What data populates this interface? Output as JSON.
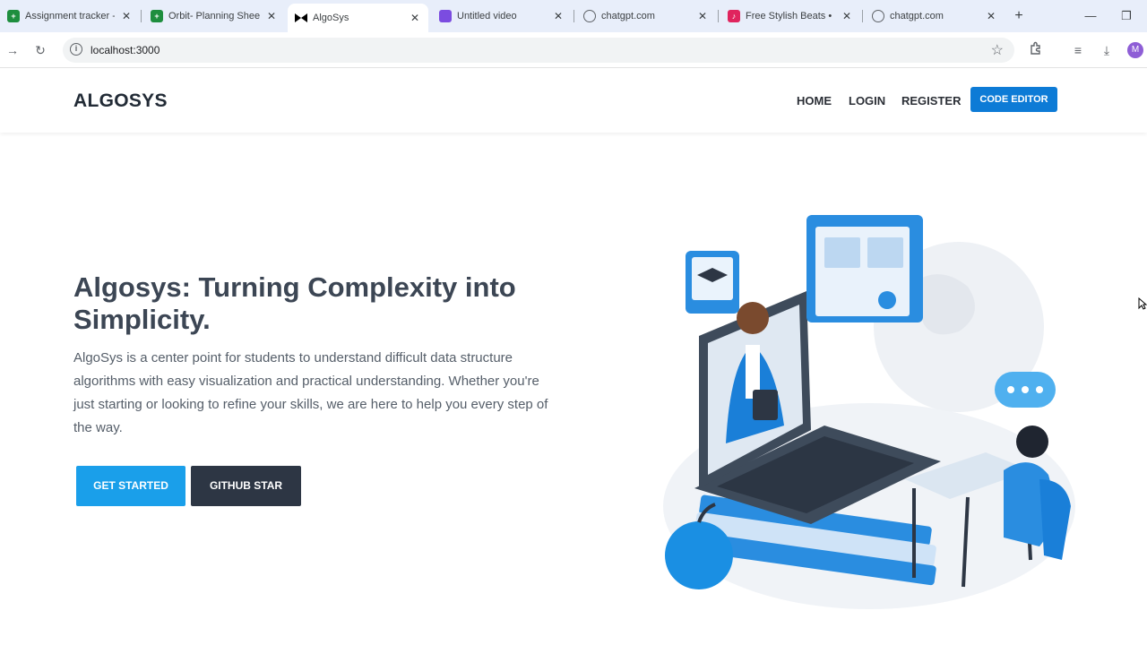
{
  "browser": {
    "tabs": [
      {
        "title": "Assignment tracker -",
        "icon": "sheets-icon",
        "color": "#1e8e3e"
      },
      {
        "title": "Orbit- Planning Shee",
        "icon": "sheets-icon",
        "color": "#1e8e3e"
      },
      {
        "title": "AlgoSys",
        "icon": "algosys-icon",
        "color": "#000000",
        "active": true
      },
      {
        "title": "Untitled video",
        "icon": "clipchamp-icon",
        "color": "#7b4ce0"
      },
      {
        "title": "chatgpt.com",
        "icon": "globe-icon",
        "color": "#5f6368"
      },
      {
        "title": "Free Stylish Beats • U",
        "icon": "beats-icon",
        "color": "#e0245e"
      },
      {
        "title": "chatgpt.com",
        "icon": "globe-icon",
        "color": "#5f6368"
      }
    ],
    "url": "localhost:3000",
    "profile_initial": "M"
  },
  "site": {
    "brand": "ALGOSYS",
    "nav": {
      "home": "HOME",
      "login": "LOGIN",
      "register": "REGISTER",
      "code_editor": "CODE EDITOR"
    },
    "hero": {
      "title": "Algosys: Turning Complexity into Simplicity.",
      "description": "AlgoSys is a center point for students to understand difficult data structure algorithms with easy visualization and practical understanding. Whether you're just starting or looking to refine your skills, we are here to help you every step of the way.",
      "get_started": "GET STARTED",
      "github_star": "GITHUB STAR"
    }
  },
  "colors": {
    "accent": "#1a9fea",
    "editor_button": "#0d7bd6",
    "dark_button": "#2d3644",
    "tabbar": "#e8eefa"
  }
}
